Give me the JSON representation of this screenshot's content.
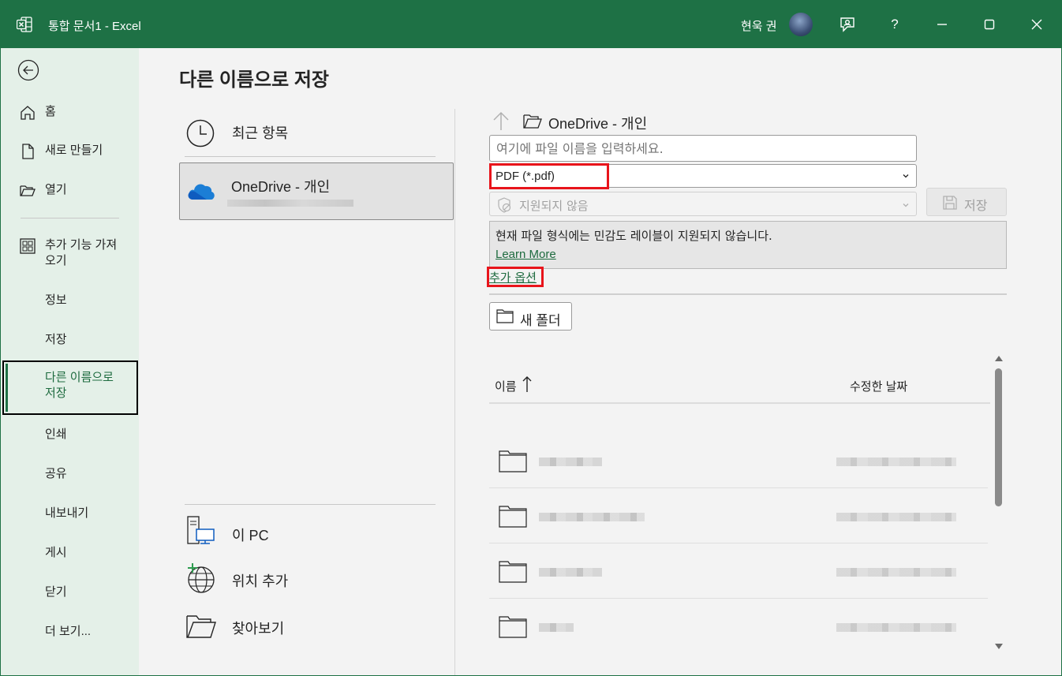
{
  "titlebar": {
    "title": "통합 문서1  -  Excel",
    "user_name": "현욱 권",
    "help_label": "?"
  },
  "nav": {
    "items": [
      {
        "label": "홈",
        "icon": "home-icon"
      },
      {
        "label": "새로 만들기",
        "icon": "new-document-icon"
      },
      {
        "label": "열기",
        "icon": "open-folder-icon"
      },
      {
        "label": "추가 기능 가져\n오기",
        "icon": "addins-grid-icon"
      },
      {
        "label": "정보"
      },
      {
        "label": "저장"
      },
      {
        "label": "다른 이름으로\n저장",
        "active": true
      },
      {
        "label": "인쇄"
      },
      {
        "label": "공유"
      },
      {
        "label": "내보내기"
      },
      {
        "label": "게시"
      },
      {
        "label": "닫기"
      },
      {
        "label": "더 보기..."
      }
    ]
  },
  "page_title": "다른 이름으로 저장",
  "locations": {
    "recent": "최근 항목",
    "onedrive": "OneDrive - 개인",
    "this_pc": "이 PC",
    "add_place": "위치 추가",
    "browse": "찾아보기"
  },
  "save": {
    "path": "OneDrive - 개인",
    "filename_placeholder": "여기에 파일 이름을 입력하세요.",
    "file_type": "PDF (*.pdf)",
    "sensitivity": "지원되지 않음",
    "save_label": "저장",
    "info_message": "현재 파일 형식에는 민감도 레이블이 지원되지 않습니다.",
    "learn_more": "Learn More",
    "more_options": "추가 옵션",
    "new_folder": "새 폴더"
  },
  "file_list": {
    "col_name": "이름",
    "col_date": "수정한 날짜",
    "rows": 4
  },
  "colors": {
    "accent": "#1e7145",
    "highlight": "#e8141b",
    "link": "#1e6b3f"
  }
}
